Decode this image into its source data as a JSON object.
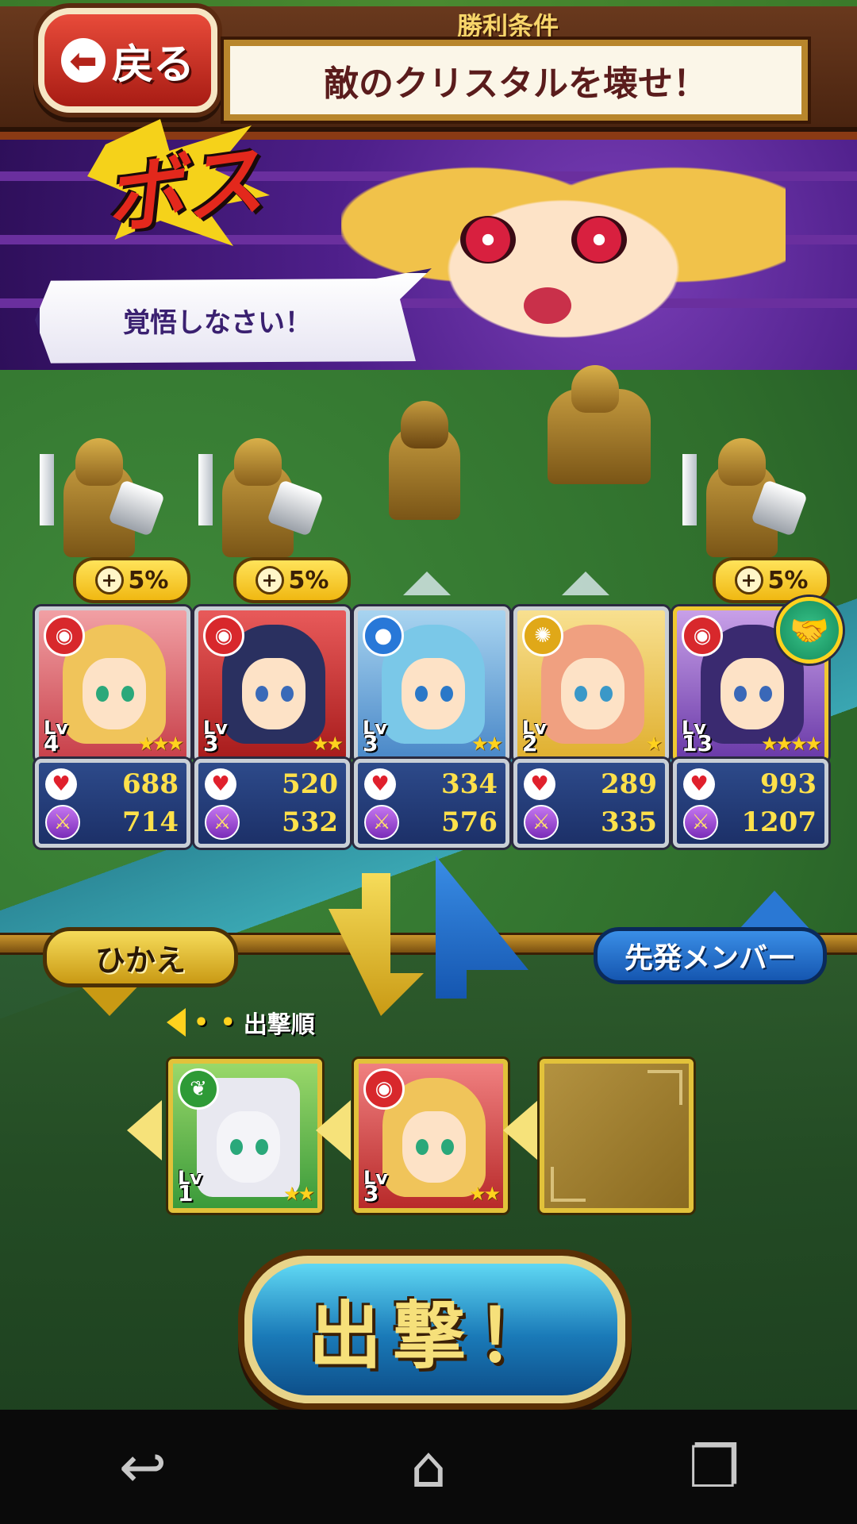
{
  "header": {
    "back_label": "戻る",
    "win_condition_label": "勝利条件",
    "win_condition_text": "敵のクリスタルを壊せ！"
  },
  "boss": {
    "badge_text": "ボス",
    "speech": "覚悟しなさい！"
  },
  "enemy_bonuses": [
    "5%",
    "5%",
    "5%"
  ],
  "starters": [
    {
      "level_label": "Lv",
      "level": "4",
      "stars": "★★★",
      "hp": "688",
      "atk": "714",
      "element": "fire",
      "element_color": "#d8282c"
    },
    {
      "level_label": "Lv",
      "level": "3",
      "stars": "★★",
      "hp": "520",
      "atk": "532",
      "element": "fire",
      "element_color": "#d8282c"
    },
    {
      "level_label": "Lv",
      "level": "3",
      "stars": "★★",
      "hp": "334",
      "atk": "576",
      "element": "water",
      "element_color": "#2878d8"
    },
    {
      "level_label": "Lv",
      "level": "2",
      "stars": "★",
      "hp": "289",
      "atk": "335",
      "element": "light",
      "element_color": "#e0a818"
    },
    {
      "level_label": "Lv",
      "level": "13",
      "stars": "★★★★",
      "hp": "993",
      "atk": "1207",
      "element": "fire",
      "element_color": "#d8282c"
    }
  ],
  "swap": {
    "reserve_label": "ひかえ",
    "starter_label": "先発メンバー",
    "order_label": "出撃順",
    "order_dots": "• •"
  },
  "reserves": [
    {
      "level_label": "Lv",
      "level": "1",
      "stars": "★★",
      "element": "wind",
      "element_color": "#2e9a36"
    },
    {
      "level_label": "Lv",
      "level": "3",
      "stars": "★★",
      "element": "fire",
      "element_color": "#d8282c"
    }
  ],
  "sortie": {
    "label": "出撃！"
  },
  "nav": {
    "back_icon": "↩",
    "home_icon": "⌂",
    "recents_icon": "❐"
  }
}
